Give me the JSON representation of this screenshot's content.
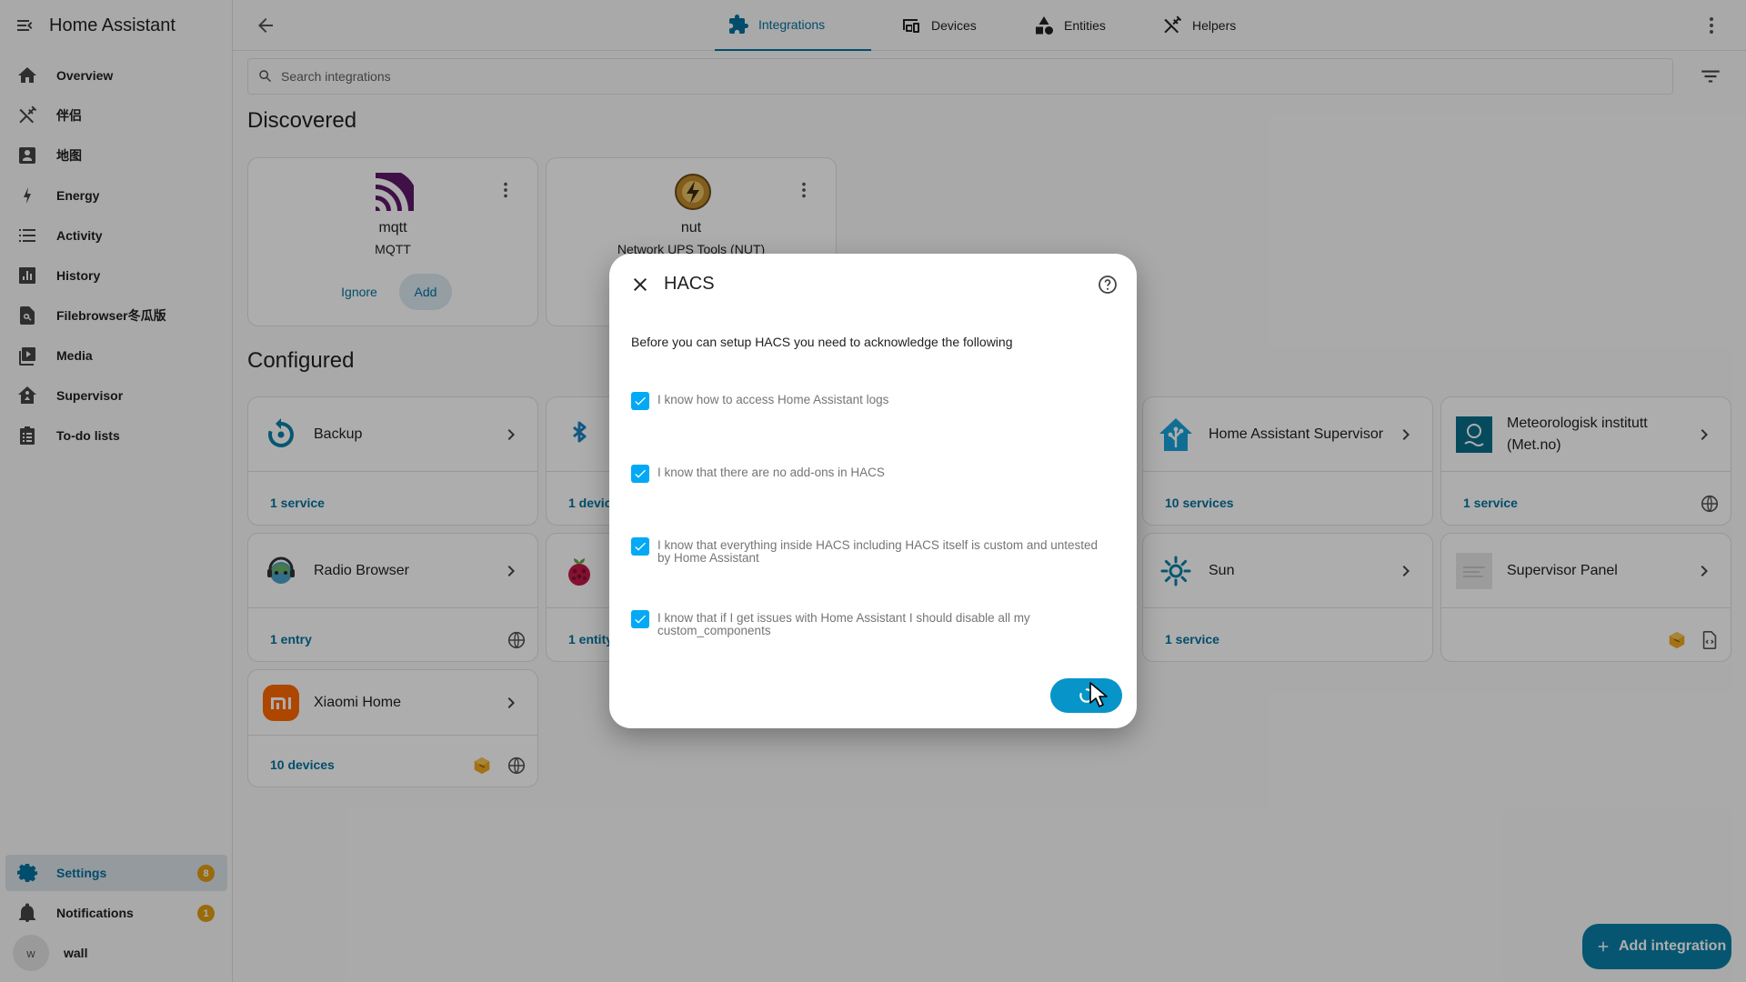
{
  "app": {
    "title": "Home Assistant"
  },
  "sidebar": {
    "items": [
      {
        "label": "Overview",
        "icon": "home-icon"
      },
      {
        "label": "伴侣",
        "icon": "tools-icon"
      },
      {
        "label": "地图",
        "icon": "map-icon"
      },
      {
        "label": "Energy",
        "icon": "lightning-icon"
      },
      {
        "label": "Activity",
        "icon": "list-icon"
      },
      {
        "label": "History",
        "icon": "chart-icon"
      },
      {
        "label": "Filebrowser冬瓜版",
        "icon": "file-search-icon"
      },
      {
        "label": "Media",
        "icon": "media-icon"
      },
      {
        "label": "Supervisor",
        "icon": "supervisor-icon"
      },
      {
        "label": "To-do lists",
        "icon": "clipboard-icon"
      }
    ],
    "settings": {
      "label": "Settings",
      "badge": "8"
    },
    "notifications": {
      "label": "Notifications",
      "badge": "1"
    },
    "user": {
      "initial": "w",
      "name": "wall"
    }
  },
  "tabs": [
    {
      "label": "Integrations",
      "active": true
    },
    {
      "label": "Devices"
    },
    {
      "label": "Entities"
    },
    {
      "label": "Helpers"
    }
  ],
  "search": {
    "placeholder": "Search integrations"
  },
  "discovered": {
    "title": "Discovered",
    "cards": [
      {
        "name": "mqtt",
        "subtitle": "MQTT",
        "ignore": "Ignore",
        "add": "Add"
      },
      {
        "name": "nut",
        "subtitle": "Network UPS Tools (NUT)"
      }
    ]
  },
  "configured": {
    "title": "Configured",
    "cards": [
      {
        "name": "Backup",
        "footer": "1 service"
      },
      {
        "name": "",
        "footer": "1 devic"
      },
      {
        "name": "Home Assistant Supervisor",
        "footer": "10 services"
      },
      {
        "name": "Meteorologisk institutt (Met.no)",
        "footer": "1 service"
      },
      {
        "name": "Radio Browser",
        "footer": "1 entry"
      },
      {
        "name": "",
        "footer": "1 entity"
      },
      {
        "name": "Sun",
        "footer": "1 service"
      },
      {
        "name": "Supervisor Panel",
        "footer": ""
      },
      {
        "name": "Xiaomi Home",
        "footer": "10 devices"
      }
    ]
  },
  "dialog": {
    "title": "HACS",
    "intro": "Before you can setup HACS you need to acknowledge the following",
    "checks": [
      {
        "label": "I know how to access Home Assistant logs",
        "checked": true
      },
      {
        "label": "I know that there are no add-ons in HACS",
        "checked": true
      },
      {
        "label": "I know that everything inside HACS including HACS itself is custom and untested by Home Assistant",
        "checked": true
      },
      {
        "label": "I know that if I get issues with Home Assistant I should disable all my custom_components",
        "checked": true
      }
    ]
  },
  "fab": {
    "label": "Add integration"
  },
  "colors": {
    "primary": "#03729e",
    "accent": "#03a9f4",
    "badge": "#e39e13"
  }
}
